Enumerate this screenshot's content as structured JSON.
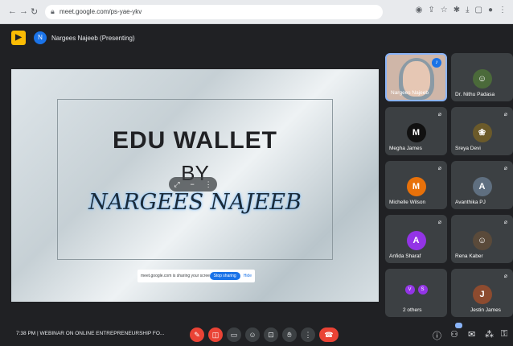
{
  "browser": {
    "url": "meet.google.com/ps-yae-ykv"
  },
  "meet": {
    "presenting_label": "Nargees Najeeb (Presenting)"
  },
  "slide": {
    "line1": "EDU WALLET",
    "line2": "BY",
    "line3": "NARGEES NAJEEB"
  },
  "share_bar": {
    "text": "meet.google.com is sharing your screen",
    "stop_label": "Stop sharing",
    "hide_label": "Hide"
  },
  "participants": [
    {
      "name": "Nargees Najeeb",
      "type": "video"
    },
    {
      "name": "Dr. Nithu Padasa",
      "type": "photo",
      "color": "#4b6a3a"
    },
    {
      "name": "Megha James",
      "type": "avatar",
      "initial": "M",
      "color": "#111111"
    },
    {
      "name": "Sreya Devi",
      "type": "photo",
      "color": "#6b5a2a"
    },
    {
      "name": "Michelle Wilson",
      "type": "avatar",
      "initial": "M",
      "color": "#e8710a"
    },
    {
      "name": "Avanthika PJ",
      "type": "avatar",
      "initial": "A",
      "color": "#5f6f80"
    },
    {
      "name": "Anfida Sharaf",
      "type": "avatar",
      "initial": "A",
      "color": "#9334e6"
    },
    {
      "name": "Rena Kaber",
      "type": "photo",
      "color": "#5a4a3a"
    },
    {
      "name": "2 others",
      "type": "dual",
      "initials": [
        "V",
        "S"
      ]
    },
    {
      "name": "Jestin James",
      "type": "avatar",
      "initial": "J",
      "color": "#8d4b2f"
    }
  ],
  "bottom": {
    "time": "7:38 PM",
    "separator": "|",
    "meeting_title": "WEBINAR ON ONLINE ENTREPRENEURSHIP FO..."
  },
  "colors": {
    "accent": "#1a73e8",
    "danger": "#ea4335",
    "meet_bg": "#202124",
    "tile_bg": "#3c4043"
  }
}
